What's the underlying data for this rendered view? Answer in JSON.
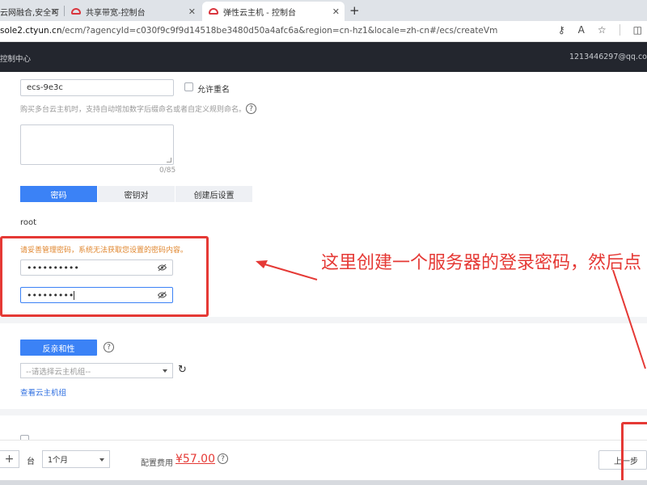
{
  "browser": {
    "tabs": [
      {
        "label": "云网融合,安全可"
      },
      {
        "label": "共享带宽-控制台"
      },
      {
        "label": "弹性云主机 - 控制台"
      }
    ],
    "new_tab": "+",
    "close_glyph": "✕",
    "url_host": "sole2.ctyun.cn",
    "url_rest": "/ecm/?agencyId=c030f9c9f9d14518be3480d50a4afc6a&region=cn-hz1&locale=zh-cn#/ecs/createVm",
    "icons": [
      "key-icon",
      "read-aloud-icon",
      "favorite-icon",
      "split-screen-icon"
    ],
    "icon_glyphs": {
      "key": "⚷",
      "read_aloud": "A",
      "favorite": "☆",
      "split": "◫"
    }
  },
  "console": {
    "title": "控制中心",
    "user": "1213446297@qq.co"
  },
  "form": {
    "instance_name": "ecs-9e3c",
    "allow_duplicate_label": "允许重名",
    "naming_hint": "购买多台云主机时，支持自动增加数字后缀命名或者自定义规则命名。",
    "help_glyph": "?",
    "description_count": "0/85",
    "login_tabs": [
      "密码",
      "密钥对",
      "创建后设置"
    ],
    "username": "root",
    "password_warning": "请妥善管理密码，系统无法获取您设置的密码内容。",
    "password_mask": "••••••••••",
    "confirm_mask": "•••••••••",
    "affinity_button": "反亲和性",
    "host_group_placeholder": "--请选择云主机组--",
    "refresh_glyph": "↻",
    "view_host_groups_link": "查看云主机组"
  },
  "annotation": {
    "text": "这里创建一个服务器的登录密码，然后点"
  },
  "footer": {
    "minus": "−",
    "plus": "+",
    "unit": "台",
    "duration": "1个月",
    "fee_label": "配置费用",
    "price": "¥57.00",
    "prev_button": "上一步"
  },
  "colors": {
    "primary": "#3b82f6",
    "annotation_red": "#e53935",
    "warning_orange": "#e0862e",
    "header_dark": "#23262e"
  }
}
